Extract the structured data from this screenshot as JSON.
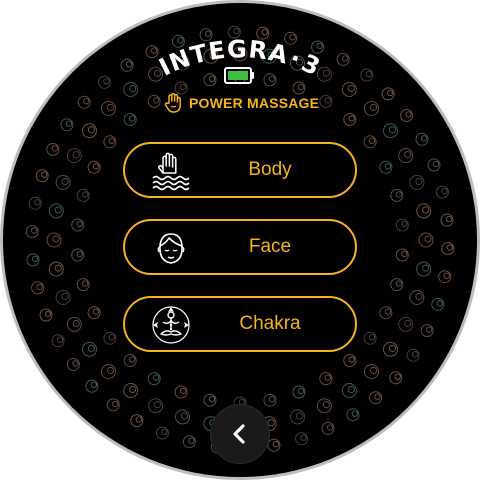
{
  "brand": {
    "name": "INTEGRA",
    "separator": "·",
    "number": "3"
  },
  "status": {
    "battery_icon": "battery-icon",
    "battery_level": 1.0,
    "battery_color": "#3fbf3f"
  },
  "mode": {
    "icon": "hand-icon",
    "label": "POWER MASSAGE"
  },
  "menu": {
    "items": [
      {
        "icon": "hand-waves-icon",
        "label": "Body"
      },
      {
        "icon": "face-icon",
        "label": "Face"
      },
      {
        "icon": "meditation-icon",
        "label": "Chakra"
      }
    ]
  },
  "nav": {
    "back_icon": "chevron-left-icon"
  },
  "theme": {
    "accent": "#f7b21c",
    "background": "#000000",
    "text": "#ffffff"
  }
}
